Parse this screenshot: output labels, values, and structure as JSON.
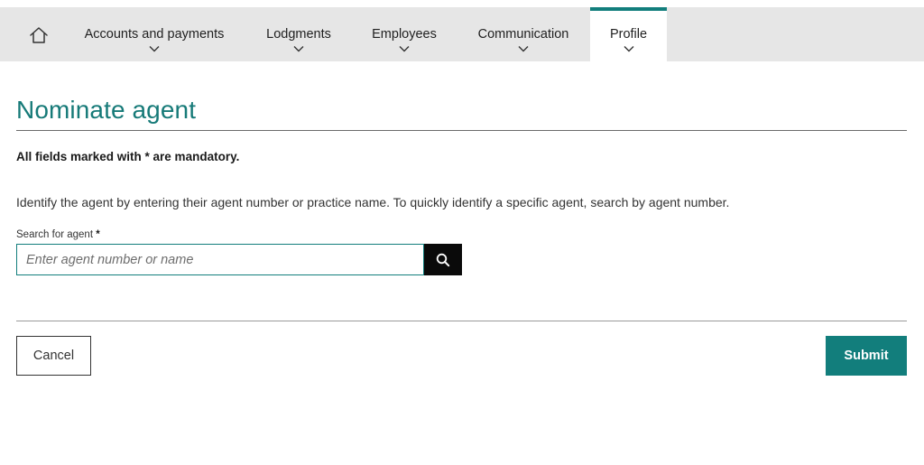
{
  "nav": {
    "home_icon": "home-icon",
    "items": [
      {
        "label": "Accounts and payments",
        "icon": "chevron-down-icon"
      },
      {
        "label": "Lodgments",
        "icon": "chevron-down-icon"
      },
      {
        "label": "Employees",
        "icon": "chevron-down-icon"
      },
      {
        "label": "Communication",
        "icon": "chevron-down-icon"
      },
      {
        "label": "Profile",
        "icon": "chevron-down-icon",
        "active": true
      }
    ]
  },
  "page": {
    "title": "Nominate agent",
    "mandatory_note": "All fields marked with * are mandatory.",
    "intro": "Identify the agent by entering their agent number or practice name. To quickly identify a specific agent, search by agent number."
  },
  "search": {
    "label": "Search for agent",
    "required_marker": "*",
    "placeholder": "Enter agent number or name",
    "value": "",
    "button_icon": "search-icon"
  },
  "actions": {
    "cancel_label": "Cancel",
    "submit_label": "Submit"
  },
  "colors": {
    "accent": "#127e7c",
    "nav_bg": "#e6e6e6",
    "search_button_bg": "#0a0a0a"
  }
}
